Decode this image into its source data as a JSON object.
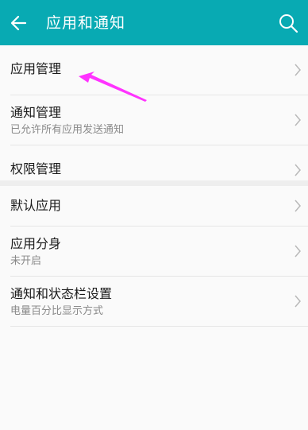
{
  "header": {
    "title": "应用和通知",
    "back_icon": "arrow-left-icon",
    "search_icon": "search-icon",
    "color": "#08aab3"
  },
  "group1": [
    {
      "label": "应用管理",
      "sub": ""
    },
    {
      "label": "通知管理",
      "sub": "已允许所有应用发送通知"
    },
    {
      "label": "权限管理",
      "sub": ""
    }
  ],
  "group2": [
    {
      "label": "默认应用",
      "sub": ""
    },
    {
      "label": "应用分身",
      "sub": "未开启"
    },
    {
      "label": "通知和状态栏设置",
      "sub": "电量百分比显示方式"
    }
  ],
  "annotation": {
    "icon": "pointer-arrow-icon",
    "color": "#ff33ff"
  }
}
